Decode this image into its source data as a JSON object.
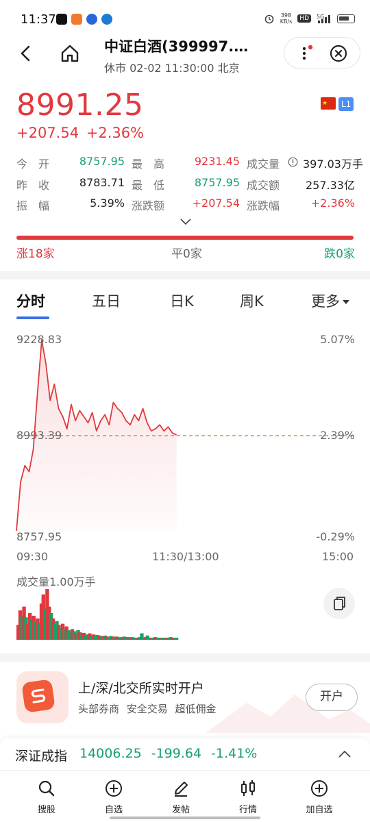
{
  "status_bar": {
    "time": "11:37",
    "net_speed": "398",
    "net_unit": "KB/s",
    "hd": "HD",
    "signal": "5G"
  },
  "header": {
    "title": "中证白酒(399997.…",
    "subtitle": "休市 02-02 11:30:00 北京"
  },
  "quote": {
    "price": "8991.25",
    "change": "+207.54 +2.36%",
    "market_badge": "L1",
    "color_up": "#e0393e",
    "color_down": "#16a16a"
  },
  "stats": {
    "open_label": "今　开",
    "open_value": "8757.95",
    "high_label": "最　高",
    "high_value": "9231.45",
    "volume_label": "成交量",
    "volume_value": "397.03万手",
    "prev_close_label": "昨　收",
    "prev_close_value": "8783.71",
    "low_label": "最　低",
    "low_value": "8757.95",
    "amount_label": "成交额",
    "amount_value": "257.33亿",
    "amplitude_label": "振　幅",
    "amplitude_value": "5.39%",
    "change_amt_label": "涨跌额",
    "change_amt_value": "+207.54",
    "change_pct_label": "涨跌幅",
    "change_pct_value": "+2.36%"
  },
  "breadth": {
    "up": "涨18家",
    "flat": "平0家",
    "down": "跌0家"
  },
  "tabs": [
    "分时",
    "五日",
    "日K",
    "周K",
    "更多"
  ],
  "chart_data": {
    "type": "line",
    "title": "",
    "y_left_ticks": [
      "9228.83",
      "8993.39",
      "8757.95"
    ],
    "y_right_ticks": [
      "5.07%",
      "2.39%",
      "-0.29%"
    ],
    "x_ticks": [
      "09:30",
      "11:30/13:00",
      "15:00"
    ],
    "ylim": [
      8757.95,
      9228.83
    ],
    "reference_price": 8993.39,
    "price_series": [
      8760,
      8880,
      8920,
      8905,
      8960,
      9100,
      9228,
      9170,
      9080,
      9120,
      9060,
      9040,
      9010,
      9070,
      9030,
      9055,
      9040,
      9025,
      9050,
      9005,
      9030,
      9045,
      9020,
      9075,
      9060,
      9050,
      9030,
      9020,
      9045,
      9030,
      9060,
      9025,
      9005,
      9010,
      9020,
      9005,
      9015,
      9000,
      8995
    ],
    "volume_label": "成交量1.00万手",
    "volume_series": [
      0.28,
      0.55,
      0.45,
      0.62,
      0.42,
      0.3,
      0.5,
      0.38,
      0.45,
      0.35,
      0.4,
      0.32,
      0.68,
      0.85,
      0.58,
      0.95,
      0.62,
      0.5,
      0.4,
      0.3,
      0.35,
      0.28,
      0.22,
      0.3,
      0.2,
      0.25,
      0.18,
      0.15,
      0.2,
      0.16,
      0.12,
      0.18,
      0.14,
      0.1,
      0.13,
      0.09,
      0.1,
      0.12,
      0.08,
      0.1,
      0.07,
      0.09,
      0.08,
      0.06,
      0.07,
      0.08,
      0.06,
      0.05,
      0.07,
      0.06,
      0.05,
      0.06,
      0.05,
      0.04,
      0.05,
      0.06,
      0.04,
      0.05,
      0.04,
      0.05,
      0.04,
      0.03,
      0.04,
      0.05,
      0.12,
      0.04,
      0.05,
      0.08,
      0.04,
      0.03,
      0.04,
      0.05,
      0.03,
      0.04,
      0.03,
      0.04,
      0.03,
      0.04,
      0.03,
      0.05,
      0.04,
      0.03,
      0.04
    ],
    "volume_up_flags": [
      1,
      1,
      0,
      1,
      0,
      1,
      1,
      0,
      1,
      0,
      1,
      0,
      1,
      1,
      0,
      1,
      1,
      0,
      1,
      0,
      0,
      1,
      0,
      1,
      0,
      1,
      0,
      0,
      1,
      0,
      1,
      0,
      1,
      0,
      1,
      0,
      0,
      1,
      0,
      1,
      0,
      0,
      1,
      0,
      1,
      0,
      1,
      0,
      0,
      1,
      0,
      1,
      0,
      0,
      1,
      0,
      0,
      1,
      0,
      1,
      0,
      0,
      1,
      0,
      0,
      0,
      1,
      0,
      0,
      1,
      0,
      1,
      0,
      0,
      1,
      0,
      0,
      1,
      0,
      0,
      1,
      0,
      0
    ]
  },
  "promo": {
    "title": "上/深/北交所实时开户",
    "subtitle": "头部券商 安全交易 超低佣金",
    "button": "开户"
  },
  "ticker": {
    "name": "深证成指",
    "values": "14006.25 -199.64 -1.41%"
  },
  "nav": {
    "search": "搜股",
    "watchlist": "自选",
    "post": "发帖",
    "market": "行情",
    "add_watch": "加自选"
  }
}
